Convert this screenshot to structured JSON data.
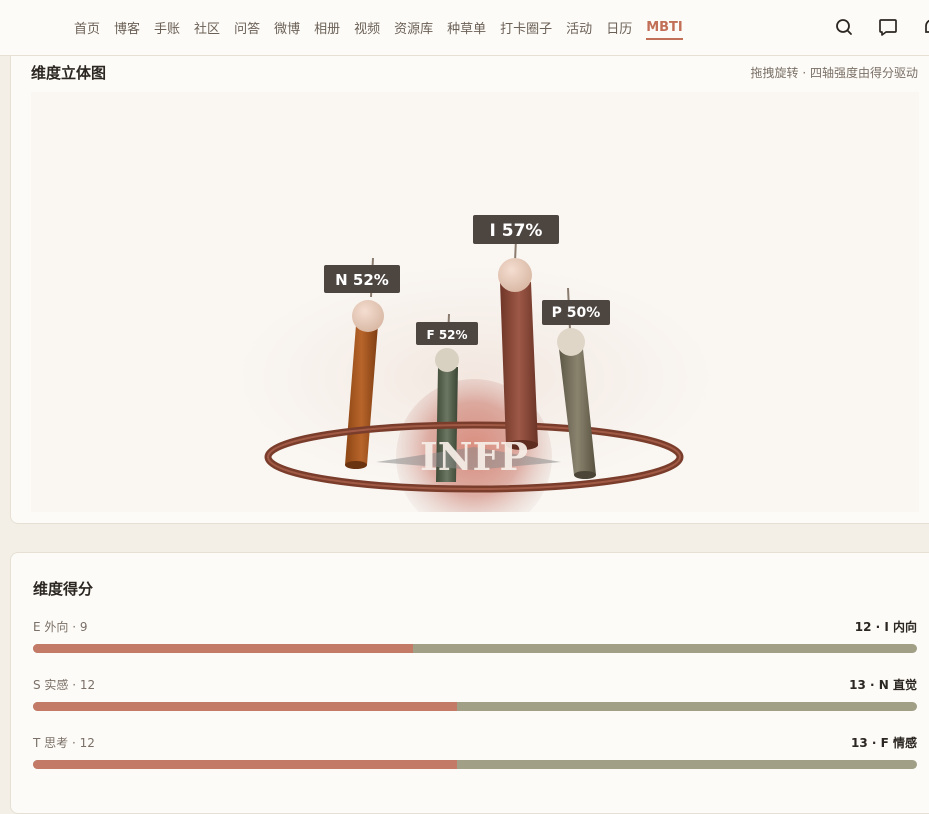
{
  "nav": {
    "items": [
      "首页",
      "博客",
      "手账",
      "社区",
      "问答",
      "微博",
      "相册",
      "视频",
      "资源库",
      "种草单",
      "打卡圈子",
      "活动",
      "日历",
      "MBTI"
    ],
    "active": "MBTI"
  },
  "header_icons": [
    "search-icon",
    "chat-bubble-icon",
    "bell-icon"
  ],
  "cube_card": {
    "title": "维度立体图",
    "hint": "拖拽旋转 · 四轴强度由得分驱动",
    "type_label": "INFP",
    "pillars": [
      {
        "label": "N 52%",
        "color": "#a5561e"
      },
      {
        "label": "F 52%",
        "color": "#5a6651"
      },
      {
        "label": "I 57%",
        "color": "#8c4b3c"
      },
      {
        "label": "P 50%",
        "color": "#76705c"
      }
    ]
  },
  "score_card": {
    "title": "维度得分",
    "rows": [
      {
        "left": "E 外向 · 9",
        "right": "12 · I 内向",
        "fill": 0.43
      },
      {
        "left": "S 实感 · 12",
        "right": "13 · N 直觉",
        "fill": 0.48
      },
      {
        "left": "T 思考 · 12",
        "right": "13 · F 情感",
        "fill": 0.48
      }
    ]
  },
  "colors": {
    "accent": "#c26f58",
    "bar_fill": "#c37a66",
    "bar_track": "#a19f86"
  }
}
